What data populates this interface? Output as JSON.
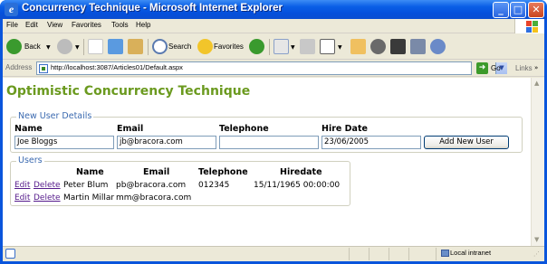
{
  "window": {
    "title": "Concurrency Technique - Microsoft Internet Explorer",
    "minimize_glyph": "_",
    "maximize_glyph": "□",
    "close_glyph": "✕"
  },
  "menu": {
    "items": [
      "File",
      "Edit",
      "View",
      "Favorites",
      "Tools",
      "Help"
    ]
  },
  "toolbar": {
    "back_label": "Back",
    "search_label": "Search",
    "favorites_label": "Favorites"
  },
  "address": {
    "label": "Address",
    "url": "http://localhost:3087/Articles01/Default.aspx",
    "go_label": "Go",
    "links_label": "Links"
  },
  "page": {
    "title": "Optimistic Concurrency Technique",
    "new_user": {
      "legend": "New User Details",
      "name_label": "Name",
      "email_label": "Email",
      "telephone_label": "Telephone",
      "hire_date_label": "Hire Date",
      "name_value": "Joe Bloggs",
      "email_value": "jb@bracora.com",
      "telephone_value": "",
      "hire_date_value": "23/06/2005",
      "add_button": "Add New User"
    },
    "users": {
      "legend": "Users",
      "columns": [
        "Name",
        "Email",
        "Telephone",
        "Hiredate"
      ],
      "edit_label": "Edit",
      "delete_label": "Delete",
      "rows": [
        {
          "name": "Peter Blum",
          "email": "pb@bracora.com",
          "telephone": "012345",
          "hiredate": "15/11/1965 00:00:00"
        },
        {
          "name": "Martin Millar",
          "email": "mm@bracora.com",
          "telephone": "",
          "hiredate": ""
        }
      ]
    }
  },
  "status": {
    "zone": "Local intranet"
  },
  "colors": {
    "title_bar": "#0a5fe6",
    "page_title": "#6b9a1f",
    "legend": "#3b6ab0",
    "visited_link": "#551a8b"
  }
}
